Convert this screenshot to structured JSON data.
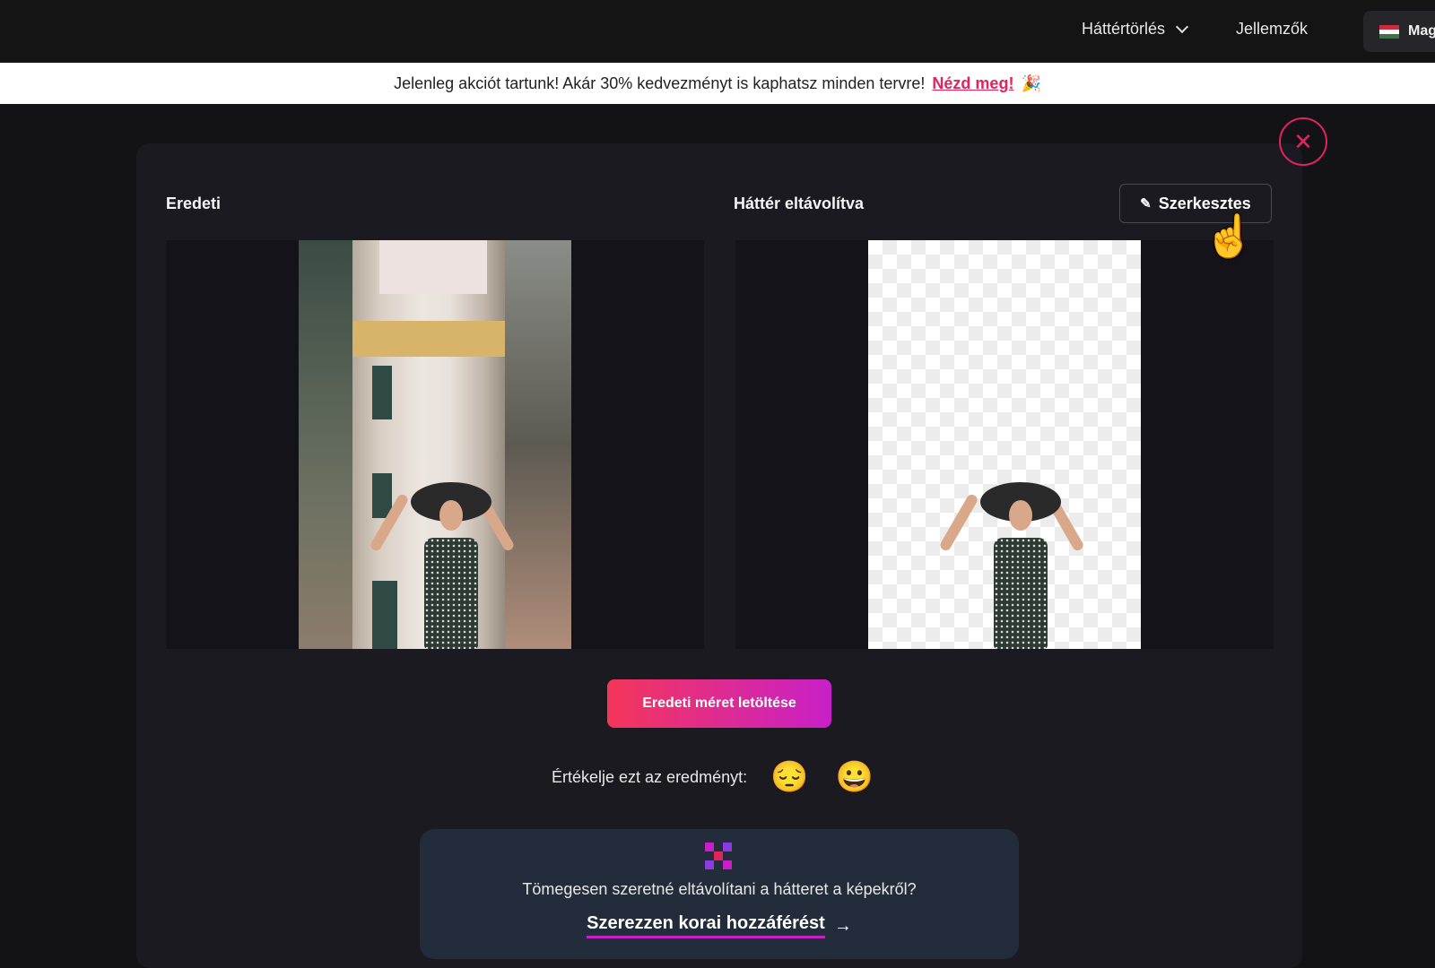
{
  "nav": {
    "bg_removal": "Háttértörlés",
    "features": "Jellemzők",
    "language": "Mag"
  },
  "promo": {
    "text": "Jelenleg akciót tartunk! Akár 30% kedvezményt is kaphatsz minden tervre!",
    "link": "Nézd meg!",
    "icon": "🎉"
  },
  "panels": {
    "original_title": "Eredeti",
    "removed_title": "Háttér eltávolítva",
    "edit_label": "Szerkesztes"
  },
  "download": {
    "label": "Eredeti méret letöltése"
  },
  "rating": {
    "label": "Értékelje ezt az eredményt:",
    "bad_emoji": "😔",
    "good_emoji": "😀"
  },
  "bulk": {
    "text": "Tömegesen szeretné eltávolítani a hátteret a képekről?",
    "link": "Szerezzen korai hozzáférést",
    "arrow": "→"
  },
  "colors": {
    "accent": "#e0245e",
    "gradient_start": "#f4365a",
    "gradient_end": "#c820c8"
  },
  "icons": {
    "close": "close-icon",
    "edit": "pencil-icon",
    "dropdown": "chevron-down-icon",
    "flag": "hungary-flag-icon",
    "bulk": "bulk-grid-icon",
    "cursor": "hand-pointer-cursor"
  }
}
